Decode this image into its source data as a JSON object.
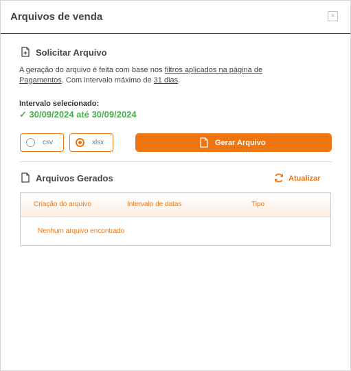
{
  "modal": {
    "title": "Arquivos de venda",
    "close_symbol": "×"
  },
  "request": {
    "heading": "Solicitar Arquivo",
    "icon": "file-plus-icon",
    "desc_part1": "A geração do arquivo é feita com base nos ",
    "desc_link1": "filtros aplicados na página de Pagamentos",
    "desc_part2": ". Com intervalo máximo de ",
    "desc_link2": "31 dias",
    "desc_part3": ".",
    "interval_label": "Intervalo selecionado:",
    "interval_value": "✓ 30/09/2024 até 30/09/2024",
    "formats": [
      {
        "label": "csv",
        "selected": false
      },
      {
        "label": "xlsx",
        "selected": true
      }
    ],
    "generate_label": "Gerar Arquivo"
  },
  "generated": {
    "heading": "Arquivos Gerados",
    "icon": "file-icon",
    "refresh_label": "Atualizar",
    "columns": [
      "Criação do arquivo",
      "Intervalo de datas",
      "Tipo"
    ],
    "empty_text": "Nenhum arquivo encontrado"
  },
  "colors": {
    "accent": "#ef7510",
    "success": "#4caf50"
  }
}
